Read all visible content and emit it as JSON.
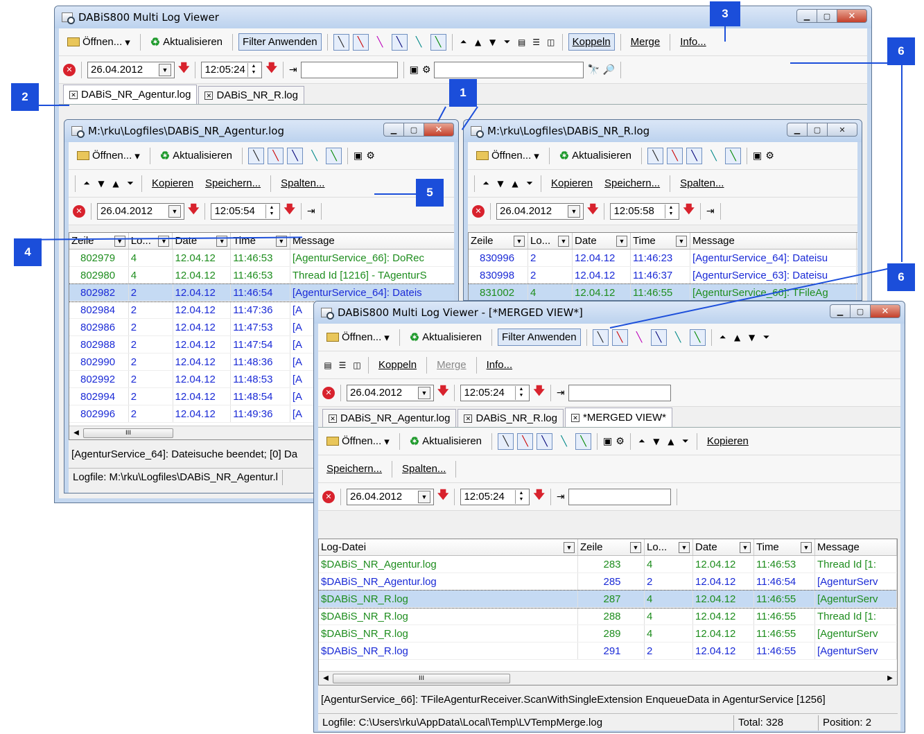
{
  "main": {
    "title": "DABiS800 Multi Log Viewer",
    "toolbar": {
      "open": "Öffnen...",
      "refresh": "Aktualisieren",
      "filter": "Filter Anwenden",
      "couple": "Koppeln",
      "merge": "Merge",
      "info": "Info..."
    },
    "date": "26.04.2012",
    "time": "12:05:24",
    "tabs": [
      "DABiS_NR_Agentur.log",
      "DABiS_NR_R.log"
    ]
  },
  "agentur": {
    "title": "M:\\rku\\Logfiles\\DABiS_NR_Agentur.log",
    "toolbar": {
      "open": "Öffnen...",
      "refresh": "Aktualisieren",
      "copy": "Kopieren",
      "save": "Speichern...",
      "columns": "Spalten..."
    },
    "date": "26.04.2012",
    "time": "12:05:54",
    "headers": [
      "Zeile",
      "Lo...",
      "Date",
      "Time",
      "Message"
    ],
    "rows": [
      [
        "802979",
        "4",
        "12.04.12",
        "11:46:53",
        "[AgenturService_66]: DoRec"
      ],
      [
        "802980",
        "4",
        "12.04.12",
        "11:46:53",
        "Thread Id [1216] - TAgenturS"
      ],
      [
        "802982",
        "2",
        "12.04.12",
        "11:46:54",
        "[AgenturService_64]: Dateis"
      ],
      [
        "802984",
        "2",
        "12.04.12",
        "11:47:36",
        "[A"
      ],
      [
        "802986",
        "2",
        "12.04.12",
        "11:47:53",
        "[A"
      ],
      [
        "802988",
        "2",
        "12.04.12",
        "11:47:54",
        "[A"
      ],
      [
        "802990",
        "2",
        "12.04.12",
        "11:48:36",
        "[A"
      ],
      [
        "802992",
        "2",
        "12.04.12",
        "11:48:53",
        "[A"
      ],
      [
        "802994",
        "2",
        "12.04.12",
        "11:48:54",
        "[A"
      ],
      [
        "802996",
        "2",
        "12.04.12",
        "11:49:36",
        "[A"
      ]
    ],
    "message": "[AgenturService_64]: Dateisuche beendet; [0] Da",
    "logfile": "Logfile: M:\\rku\\Logfiles\\DABiS_NR_Agentur.l"
  },
  "rlog": {
    "title": "M:\\rku\\Logfiles\\DABiS_NR_R.log",
    "toolbar": {
      "open": "Öffnen...",
      "refresh": "Aktualisieren",
      "copy": "Kopieren",
      "save": "Speichern...",
      "columns": "Spalten..."
    },
    "date": "26.04.2012",
    "time": "12:05:58",
    "headers": [
      "Zeile",
      "Lo...",
      "Date",
      "Time",
      "Message"
    ],
    "rows": [
      [
        "830996",
        "2",
        "12.04.12",
        "11:46:23",
        "[AgenturService_64]: Dateisu"
      ],
      [
        "830998",
        "2",
        "12.04.12",
        "11:46:37",
        "[AgenturService_63]: Dateisu"
      ],
      [
        "831002",
        "4",
        "12.04.12",
        "11:46:55",
        "[AgenturService_66]: TFileAg"
      ]
    ]
  },
  "merged": {
    "title": "DABiS800 Multi Log Viewer - [*MERGED VIEW*]",
    "toolbar": {
      "open": "Öffnen...",
      "refresh": "Aktualisieren",
      "filter": "Filter Anwenden",
      "couple": "Koppeln",
      "merge": "Merge",
      "info": "Info...",
      "copy": "Kopieren",
      "save": "Speichern...",
      "columns": "Spalten..."
    },
    "date": "26.04.2012",
    "time": "12:05:24",
    "tabs": [
      "DABiS_NR_Agentur.log",
      "DABiS_NR_R.log",
      "*MERGED VIEW*"
    ],
    "headers": [
      "Log-Datei",
      "Zeile",
      "Lo...",
      "Date",
      "Time",
      "Message"
    ],
    "rows": [
      [
        "$DABiS_NR_Agentur.log",
        "283",
        "4",
        "12.04.12",
        "11:46:53",
        "Thread Id [1:"
      ],
      [
        "$DABiS_NR_Agentur.log",
        "285",
        "2",
        "12.04.12",
        "11:46:54",
        "[AgenturServ"
      ],
      [
        "$DABiS_NR_R.log",
        "287",
        "4",
        "12.04.12",
        "11:46:55",
        "[AgenturServ"
      ],
      [
        "$DABiS_NR_R.log",
        "288",
        "4",
        "12.04.12",
        "11:46:55",
        "Thread Id [1:"
      ],
      [
        "$DABiS_NR_R.log",
        "289",
        "4",
        "12.04.12",
        "11:46:55",
        "[AgenturServ"
      ],
      [
        "$DABiS_NR_R.log",
        "291",
        "2",
        "12.04.12",
        "11:46:55",
        "[AgenturServ"
      ]
    ],
    "message": "[AgenturService_66]: TFileAgenturReceiver.ScanWithSingleExtension EnqueueData in AgenturService [1256]",
    "logfile": "Logfile: C:\\Users\\rku\\AppData\\Local\\Temp\\LVTempMerge.log",
    "total": "Total: 328",
    "position": "Position: 2"
  },
  "callouts": [
    "1",
    "2",
    "3",
    "4",
    "5",
    "6",
    "6"
  ],
  "colors": {
    "callout": "#1b4eda",
    "level4": "#1e8d1e",
    "level2": "#1a2ad6",
    "selection": "#c5daf3"
  }
}
